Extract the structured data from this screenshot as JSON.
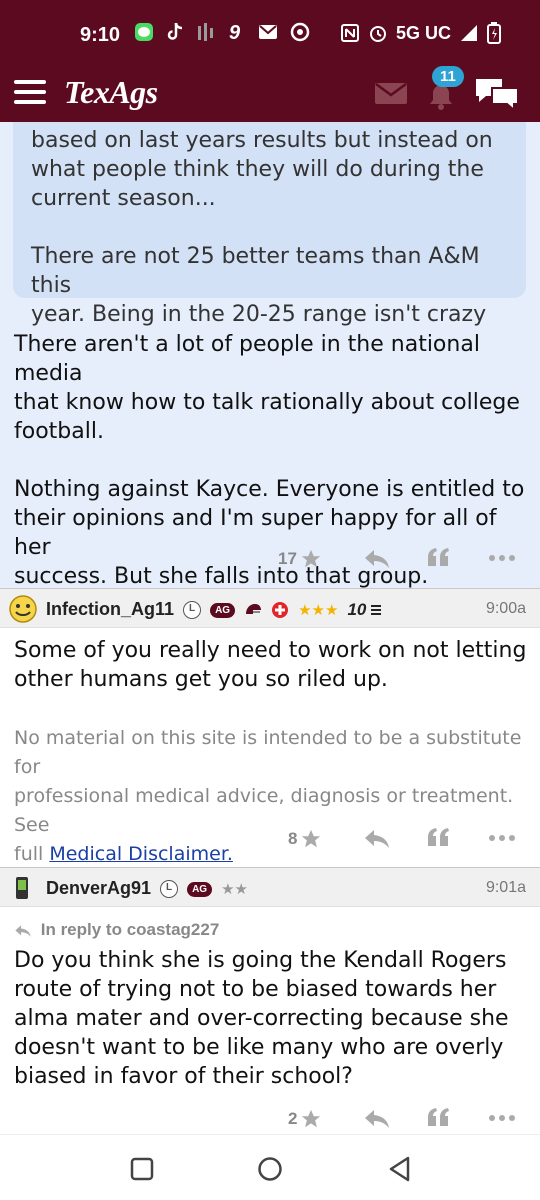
{
  "status_bar": {
    "time": "9:10",
    "network": "5G UC"
  },
  "header": {
    "logo": "TexAgs",
    "notification_count": "11"
  },
  "post1": {
    "quote_lines": [
      "based on last years results but instead on",
      "what people think they will do during the",
      "current season...",
      "",
      "There are not 25 better teams than A&M this",
      "year. Being in the 20-25 range isn't crazy"
    ],
    "body_lines": [
      "There aren't a lot of people in the national media",
      "that know how to talk rationally about college",
      "football.",
      "",
      "Nothing against Kayce. Everyone is entitled to",
      "their opinions and I'm super happy for all of her",
      "success. But she falls into that group."
    ],
    "star_count": "17"
  },
  "post2": {
    "username": "Infection_Ag11",
    "badge_l": "L",
    "badge_ag": "AG",
    "rank_number": "10",
    "time": "9:00a",
    "body_lines": [
      "Some of you really need to work on not letting",
      "other humans get you so riled up."
    ],
    "disclaimer_lines": [
      "No material on this site is intended to be a substitute for",
      "professional medical advice, diagnosis or treatment. See"
    ],
    "disclaimer_prefix": "full",
    "disclaimer_link": "Medical Disclaimer.",
    "star_count": "8"
  },
  "post3": {
    "username": "DenverAg91",
    "badge_l": "L",
    "badge_ag": "AG",
    "time": "9:01a",
    "reply_to": "In reply to coastag227",
    "body_lines": [
      "Do you think she is going the Kendall Rogers",
      "route of trying not to be biased towards her",
      "alma mater and over-correcting because she",
      "doesn't want to be like many who are overly",
      "biased in favor of their school?"
    ],
    "star_count": "2"
  },
  "icons": {
    "menu": "hamburger-icon",
    "mail": "mail-icon",
    "notifications": "bell-icon",
    "chat": "chat-icon",
    "star": "star-icon",
    "reply": "reply-icon",
    "quote": "quote-icon",
    "more": "more-icon"
  },
  "colors": {
    "brand": "#5b0a1f",
    "post_bg_highlight": "#e6eefb",
    "quote_bg": "#d3e1f6",
    "badge_blue": "#2fa3d4"
  }
}
